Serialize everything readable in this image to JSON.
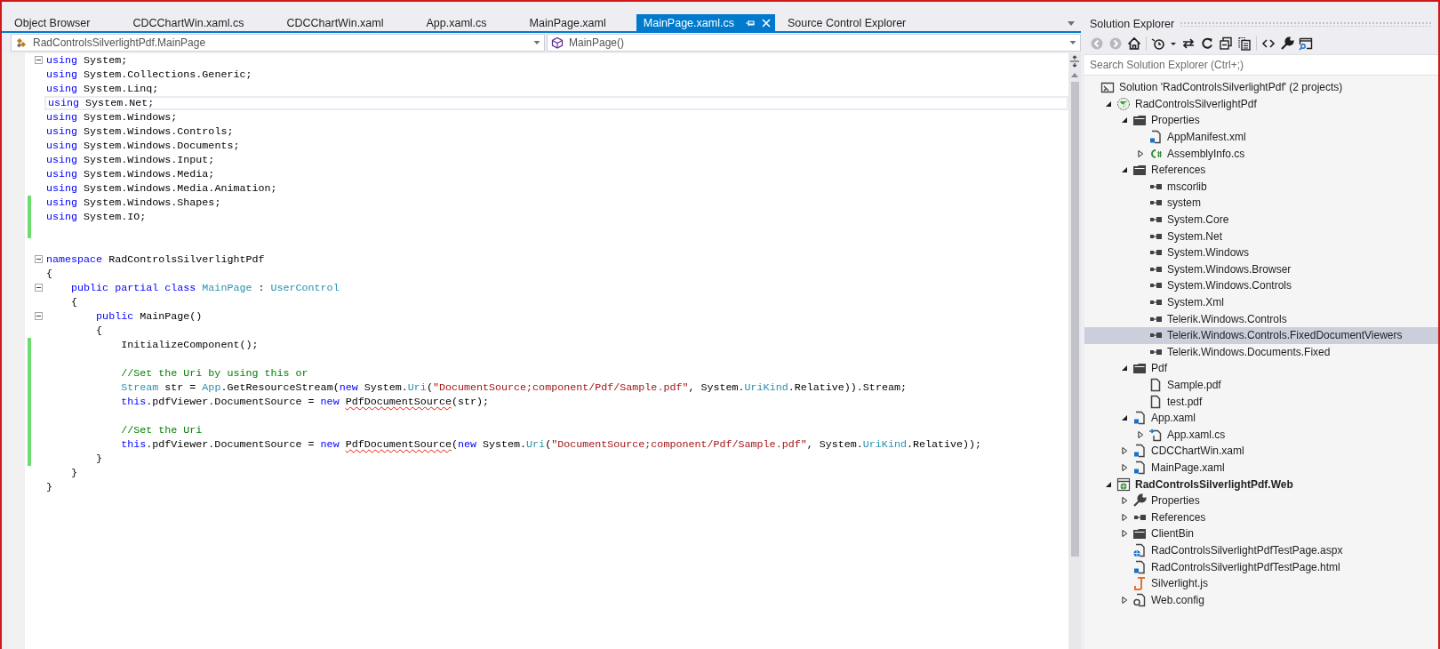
{
  "tabs": [
    {
      "label": "Object Browser",
      "selected": false
    },
    {
      "label": "CDCChartWin.xaml.cs",
      "selected": false
    },
    {
      "label": "CDCChartWin.xaml",
      "selected": false
    },
    {
      "label": "App.xaml.cs",
      "selected": false
    },
    {
      "label": "MainPage.xaml",
      "selected": false
    },
    {
      "label": "MainPage.xaml.cs",
      "selected": true
    },
    {
      "label": "Source Control Explorer",
      "selected": false
    }
  ],
  "navigation": {
    "type_dropdown": {
      "value": "RadControlsSilverlightPdf.MainPage"
    },
    "member_dropdown": {
      "value": "MainPage()"
    }
  },
  "editor": {
    "lines": [
      {
        "collapsible": true,
        "changed": false,
        "current": false,
        "tokens": [
          {
            "t": "using ",
            "kind": "keyword"
          },
          {
            "t": "System;",
            "kind": "plain"
          }
        ]
      },
      {
        "collapsible": false,
        "changed": false,
        "current": false,
        "tokens": [
          {
            "t": "using ",
            "kind": "keyword"
          },
          {
            "t": "System.Collections.Generic;",
            "kind": "plain"
          }
        ]
      },
      {
        "collapsible": false,
        "changed": false,
        "current": false,
        "tokens": [
          {
            "t": "using ",
            "kind": "keyword"
          },
          {
            "t": "System.Linq;",
            "kind": "plain"
          }
        ]
      },
      {
        "collapsible": false,
        "changed": false,
        "current": true,
        "tokens": [
          {
            "t": "using ",
            "kind": "keyword"
          },
          {
            "t": "System.Net;",
            "kind": "plain"
          }
        ]
      },
      {
        "collapsible": false,
        "changed": false,
        "current": false,
        "tokens": [
          {
            "t": "using ",
            "kind": "keyword"
          },
          {
            "t": "System.Windows;",
            "kind": "plain"
          }
        ]
      },
      {
        "collapsible": false,
        "changed": false,
        "current": false,
        "tokens": [
          {
            "t": "using ",
            "kind": "keyword"
          },
          {
            "t": "System.Windows.Controls;",
            "kind": "plain"
          }
        ]
      },
      {
        "collapsible": false,
        "changed": false,
        "current": false,
        "tokens": [
          {
            "t": "using ",
            "kind": "keyword"
          },
          {
            "t": "System.Windows.Documents;",
            "kind": "plain"
          }
        ]
      },
      {
        "collapsible": false,
        "changed": false,
        "current": false,
        "tokens": [
          {
            "t": "using ",
            "kind": "keyword"
          },
          {
            "t": "System.Windows.Input;",
            "kind": "plain"
          }
        ]
      },
      {
        "collapsible": false,
        "changed": false,
        "current": false,
        "tokens": [
          {
            "t": "using ",
            "kind": "keyword"
          },
          {
            "t": "System.Windows.Media;",
            "kind": "plain"
          }
        ]
      },
      {
        "collapsible": false,
        "changed": false,
        "current": false,
        "tokens": [
          {
            "t": "using ",
            "kind": "keyword"
          },
          {
            "t": "System.Windows.Media.Animation;",
            "kind": "plain"
          }
        ]
      },
      {
        "collapsible": false,
        "changed": true,
        "current": false,
        "tokens": [
          {
            "t": "using ",
            "kind": "keyword"
          },
          {
            "t": "System.Windows.Shapes;",
            "kind": "plain"
          }
        ]
      },
      {
        "collapsible": false,
        "changed": true,
        "current": false,
        "tokens": [
          {
            "t": "using ",
            "kind": "keyword"
          },
          {
            "t": "System.IO;",
            "kind": "plain"
          }
        ]
      },
      {
        "collapsible": false,
        "changed": true,
        "current": false
      },
      {
        "collapsible": false,
        "changed": false,
        "current": false
      },
      {
        "collapsible": true,
        "changed": false,
        "current": false,
        "tokens": [
          {
            "t": "namespace ",
            "kind": "keyword"
          },
          {
            "t": "RadControlsSilverlightPdf",
            "kind": "plain"
          }
        ]
      },
      {
        "collapsible": false,
        "changed": false,
        "current": false,
        "tokens": [
          {
            "t": "{",
            "kind": "plain"
          }
        ]
      },
      {
        "collapsible": true,
        "changed": false,
        "current": false,
        "tokens": [
          {
            "t": "    public partial class ",
            "kind": "keyword"
          },
          {
            "t": "MainPage",
            "kind": "type"
          },
          {
            "t": " : ",
            "kind": "plain"
          },
          {
            "t": "UserControl",
            "kind": "type"
          }
        ]
      },
      {
        "collapsible": false,
        "changed": false,
        "current": false,
        "tokens": [
          {
            "t": "    {",
            "kind": "plain"
          }
        ]
      },
      {
        "collapsible": true,
        "changed": false,
        "current": false,
        "tokens": [
          {
            "t": "        public ",
            "kind": "keyword"
          },
          {
            "t": "MainPage()",
            "kind": "plain"
          }
        ]
      },
      {
        "collapsible": false,
        "changed": false,
        "current": false,
        "tokens": [
          {
            "t": "        {",
            "kind": "plain"
          }
        ]
      },
      {
        "collapsible": false,
        "changed": true,
        "current": false,
        "tokens": [
          {
            "t": "            InitializeComponent();",
            "kind": "plain"
          }
        ]
      },
      {
        "collapsible": false,
        "changed": true,
        "current": false
      },
      {
        "collapsible": false,
        "changed": true,
        "current": false,
        "tokens": [
          {
            "t": "            //Set the Uri by using this or",
            "kind": "comment"
          }
        ]
      },
      {
        "collapsible": false,
        "changed": true,
        "current": false,
        "tokens": [
          {
            "t": "            Stream",
            "kind": "type"
          },
          {
            "t": " str = ",
            "kind": "plain"
          },
          {
            "t": "App",
            "kind": "type"
          },
          {
            "t": ".GetResourceStream(",
            "kind": "plain"
          },
          {
            "t": "new",
            "kind": "keyword"
          },
          {
            "t": " System.",
            "kind": "plain"
          },
          {
            "t": "Uri",
            "kind": "type"
          },
          {
            "t": "(",
            "kind": "plain"
          },
          {
            "t": "\"DocumentSource;component/Pdf/Sample.pdf\"",
            "kind": "string"
          },
          {
            "t": ", System.",
            "kind": "plain"
          },
          {
            "t": "UriKind",
            "kind": "type"
          },
          {
            "t": ".Relative)).Stream;",
            "kind": "plain"
          }
        ]
      },
      {
        "collapsible": false,
        "changed": true,
        "current": false,
        "tokens": [
          {
            "t": "            this",
            "kind": "keyword"
          },
          {
            "t": ".pdfViewer.DocumentSource = ",
            "kind": "plain"
          },
          {
            "t": "new ",
            "kind": "keyword"
          },
          {
            "t": "PdfDocumentSource",
            "kind": "error"
          },
          {
            "t": "(str);",
            "kind": "plain"
          }
        ]
      },
      {
        "collapsible": false,
        "changed": true,
        "current": false
      },
      {
        "collapsible": false,
        "changed": true,
        "current": false,
        "tokens": [
          {
            "t": "            //Set the Uri",
            "kind": "comment"
          }
        ]
      },
      {
        "collapsible": false,
        "changed": true,
        "current": false,
        "tokens": [
          {
            "t": "            this",
            "kind": "keyword"
          },
          {
            "t": ".pdfViewer.DocumentSource = ",
            "kind": "plain"
          },
          {
            "t": "new ",
            "kind": "keyword"
          },
          {
            "t": "PdfDocumentSource",
            "kind": "error"
          },
          {
            "t": "(",
            "kind": "plain"
          },
          {
            "t": "new",
            "kind": "keyword"
          },
          {
            "t": " System.",
            "kind": "plain"
          },
          {
            "t": "Uri",
            "kind": "type"
          },
          {
            "t": "(",
            "kind": "plain"
          },
          {
            "t": "\"DocumentSource;component/Pdf/Sample.pdf\"",
            "kind": "string"
          },
          {
            "t": ", System.",
            "kind": "plain"
          },
          {
            "t": "UriKind",
            "kind": "type"
          },
          {
            "t": ".Relative));",
            "kind": "plain"
          }
        ]
      },
      {
        "collapsible": false,
        "changed": true,
        "current": false,
        "tokens": [
          {
            "t": "        }",
            "kind": "plain"
          }
        ]
      },
      {
        "collapsible": false,
        "changed": false,
        "current": false,
        "tokens": [
          {
            "t": "    }",
            "kind": "plain"
          }
        ]
      },
      {
        "collapsible": false,
        "changed": false,
        "current": false,
        "tokens": [
          {
            "t": "}",
            "kind": "plain"
          }
        ]
      }
    ]
  },
  "solution_explorer": {
    "title": "Solution Explorer",
    "search": {
      "placeholder": "Search Solution Explorer (Ctrl+;)"
    },
    "toolbar": [
      {
        "kind": "back",
        "disabled": true
      },
      {
        "kind": "forward",
        "disabled": true
      },
      {
        "kind": "home",
        "disabled": false
      },
      {
        "kind": "separator"
      },
      {
        "kind": "history",
        "disabled": false
      },
      {
        "kind": "caret",
        "disabled": false
      },
      {
        "kind": "sync",
        "disabled": false
      },
      {
        "kind": "refresh",
        "disabled": false
      },
      {
        "kind": "collapse",
        "disabled": false
      },
      {
        "kind": "showall",
        "disabled": false
      },
      {
        "kind": "separator"
      },
      {
        "kind": "code",
        "disabled": false
      },
      {
        "kind": "properties",
        "disabled": false
      },
      {
        "kind": "preview",
        "disabled": false
      }
    ],
    "tree": [
      {
        "label": "Solution 'RadControlsSilverlightPdf' (2 projects)",
        "kind": "solution",
        "selected": false,
        "children": [
          {
            "label": "RadControlsSilverlightPdf",
            "kind": "project",
            "startup": false,
            "selected": false,
            "expanded": true,
            "children": [
              {
                "label": "Properties",
                "kind": "folder",
                "selected": false,
                "expanded": true,
                "children": [
                  {
                    "label": "AppManifest.xml",
                    "kind": "xaml",
                    "selected": false
                  },
                  {
                    "label": "AssemblyInfo.cs",
                    "kind": "csharp",
                    "selected": false,
                    "expanded": false
                  }
                ]
              },
              {
                "label": "References",
                "kind": "folder",
                "selected": false,
                "expanded": true,
                "children": [
                  {
                    "label": "mscorlib",
                    "kind": "reference",
                    "selected": false
                  },
                  {
                    "label": "system",
                    "kind": "reference",
                    "selected": false
                  },
                  {
                    "label": "System.Core",
                    "kind": "reference",
                    "selected": false
                  },
                  {
                    "label": "System.Net",
                    "kind": "reference",
                    "selected": false
                  },
                  {
                    "label": "System.Windows",
                    "kind": "reference",
                    "selected": false
                  },
                  {
                    "label": "System.Windows.Browser",
                    "kind": "reference",
                    "selected": false
                  },
                  {
                    "label": "System.Windows.Controls",
                    "kind": "reference",
                    "selected": false
                  },
                  {
                    "label": "System.Xml",
                    "kind": "reference",
                    "selected": false
                  },
                  {
                    "label": "Telerik.Windows.Controls",
                    "kind": "reference",
                    "selected": false
                  },
                  {
                    "label": "Telerik.Windows.Controls.FixedDocumentViewers",
                    "kind": "reference",
                    "selected": true
                  },
                  {
                    "label": "Telerik.Windows.Documents.Fixed",
                    "kind": "reference",
                    "selected": false
                  }
                ]
              },
              {
                "label": "Pdf",
                "kind": "folder",
                "selected": false,
                "expanded": true,
                "children": [
                  {
                    "label": "Sample.pdf",
                    "kind": "file",
                    "selected": false
                  },
                  {
                    "label": "test.pdf",
                    "kind": "file",
                    "selected": false
                  }
                ]
              },
              {
                "label": "App.xaml",
                "kind": "xaml",
                "selected": false,
                "expanded": true,
                "children": [
                  {
                    "label": "App.xaml.cs",
                    "kind": "codebehind",
                    "selected": false,
                    "expanded": false
                  }
                ]
              },
              {
                "label": "CDCChartWin.xaml",
                "kind": "xaml",
                "selected": false,
                "expanded": false
              },
              {
                "label": "MainPage.xaml",
                "kind": "xaml",
                "selected": false,
                "expanded": false
              }
            ]
          },
          {
            "label": "RadControlsSilverlightPdf.Web",
            "kind": "webproject",
            "startup": true,
            "selected": false,
            "expanded": true,
            "children": [
              {
                "label": "Properties",
                "kind": "wrench",
                "selected": false,
                "expanded": false
              },
              {
                "label": "References",
                "kind": "reference",
                "selected": false,
                "expanded": false
              },
              {
                "label": "ClientBin",
                "kind": "folder",
                "selected": false,
                "expanded": false
              },
              {
                "label": "RadControlsSilverlightPdfTestPage.aspx",
                "kind": "aspx",
                "selected": false
              },
              {
                "label": "RadControlsSilverlightPdfTestPage.html",
                "kind": "xaml",
                "selected": false
              },
              {
                "label": "Silverlight.js",
                "kind": "js",
                "selected": false
              },
              {
                "label": "Web.config",
                "kind": "config",
                "selected": false,
                "expanded": false
              }
            ]
          }
        ]
      }
    ]
  }
}
